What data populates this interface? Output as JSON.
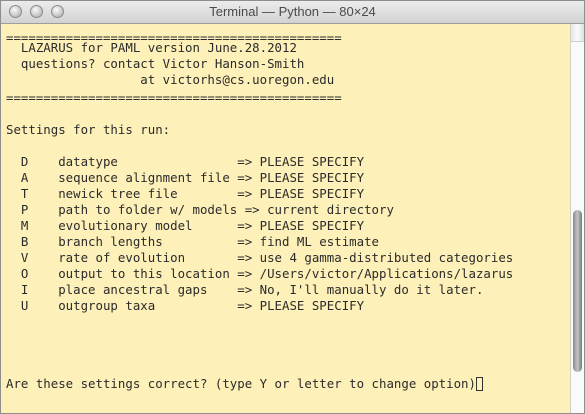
{
  "window": {
    "title": "Terminal — Python — 80×24"
  },
  "terminal": {
    "lines": [
      "=============================================",
      "  LAZARUS for PAML version June.28.2012",
      "  questions? contact Victor Hanson-Smith",
      "                  at victorhs@cs.uoregon.edu",
      "=============================================",
      "",
      "Settings for this run:",
      "",
      "  D    datatype                => PLEASE SPECIFY",
      "  A    sequence alignment file => PLEASE SPECIFY",
      "  T    newick tree file        => PLEASE SPECIFY",
      "  P    path to folder w/ models => current directory",
      "  M    evolutionary model      => PLEASE SPECIFY",
      "  B    branch lengths          => find ML estimate",
      "  V    rate of evolution       => use 4 gamma-distributed categories",
      "  O    output to this location => /Users/victor/Applications/lazarus",
      "  I    place ancestral gaps    => No, I'll manually do it later.",
      "  U    outgroup taxa           => PLEASE SPECIFY"
    ],
    "prompt": "Are these settings correct? (type Y or letter to change option)"
  }
}
